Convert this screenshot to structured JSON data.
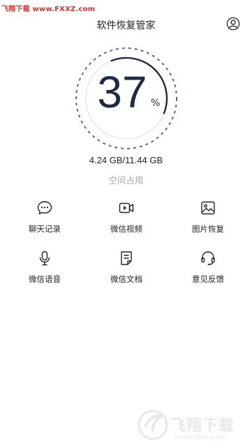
{
  "watermark_top": "飞翔下载 www.FXXZ.com",
  "header": {
    "title": "软件恢复管家",
    "user_icon": "user-icon"
  },
  "usage": {
    "percent_value": 37,
    "percent_text": "37",
    "percent_sign": "%",
    "storage_text": "4.24 GB/11.44 GB",
    "storage_label": "空间占用",
    "accent_color": "#5a6b8c",
    "arc_color": "#1f2a44"
  },
  "features": [
    {
      "label": "聊天记录",
      "icon": "chat-icon"
    },
    {
      "label": "微信视频",
      "icon": "video-icon"
    },
    {
      "label": "图片恢复",
      "icon": "image-icon"
    },
    {
      "label": "微信语音",
      "icon": "microphone-icon"
    },
    {
      "label": "微信文档",
      "icon": "document-icon"
    },
    {
      "label": "意见反馈",
      "icon": "headset-icon"
    }
  ],
  "watermark_logo": {
    "text": "飞翔下载",
    "sub": "www.fxxz.com"
  }
}
